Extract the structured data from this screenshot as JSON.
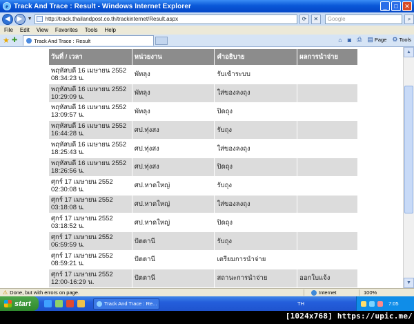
{
  "window": {
    "title": "Track And Trace : Result - Windows Internet Explorer",
    "address": "http://track.thailandpost.co.th/trackinternet/Result.aspx",
    "search_placeholder": "Google"
  },
  "menu": [
    "File",
    "Edit",
    "View",
    "Favorites",
    "Tools",
    "Help"
  ],
  "tab": {
    "label": "Track And Trace : Result"
  },
  "commands": {
    "page": "Page",
    "tools": "Tools"
  },
  "table": {
    "headers": [
      "วันที่ / เวลา",
      "หน่วยงาน",
      "คำอธิบาย",
      "ผลการนำจ่าย"
    ],
    "rows": [
      {
        "date": "พฤหัสบดี 16 เมษายน 2552",
        "time": "08:34:23 น.",
        "unit": "พัทลุง",
        "desc": "รับเข้าระบบ",
        "result": ""
      },
      {
        "date": "พฤหัสบดี 16 เมษายน 2552",
        "time": "10:29:09 น.",
        "unit": "พัทลุง",
        "desc": "ใส่ของลงถุง",
        "result": ""
      },
      {
        "date": "พฤหัสบดี 16 เมษายน 2552",
        "time": "13:09:57 น.",
        "unit": "พัทลุง",
        "desc": "ปิดถุง",
        "result": ""
      },
      {
        "date": "พฤหัสบดี 16 เมษายน 2552",
        "time": "16:44:28 น.",
        "unit": "ศป.ทุ่งสง",
        "desc": "รับถุง",
        "result": ""
      },
      {
        "date": "พฤหัสบดี 16 เมษายน 2552",
        "time": "18:25:43 น.",
        "unit": "ศป.ทุ่งสง",
        "desc": "ใส่ของลงถุง",
        "result": ""
      },
      {
        "date": "พฤหัสบดี 16 เมษายน 2552",
        "time": "18:26:56 น.",
        "unit": "ศป.ทุ่งสง",
        "desc": "ปิดถุง",
        "result": ""
      },
      {
        "date": "ศุกร์ 17 เมษายน 2552",
        "time": "02:30:08 น.",
        "unit": "ศป.หาดใหญ่",
        "desc": "รับถุง",
        "result": ""
      },
      {
        "date": "ศุกร์ 17 เมษายน 2552",
        "time": "03:18:08 น.",
        "unit": "ศป.หาดใหญ่",
        "desc": "ใส่ของลงถุง",
        "result": ""
      },
      {
        "date": "ศุกร์ 17 เมษายน 2552",
        "time": "03:18:52 น.",
        "unit": "ศป.หาดใหญ่",
        "desc": "ปิดถุง",
        "result": ""
      },
      {
        "date": "ศุกร์ 17 เมษายน 2552",
        "time": "06:59:59 น.",
        "unit": "ปัตตานี",
        "desc": "รับถุง",
        "result": ""
      },
      {
        "date": "ศุกร์ 17 เมษายน 2552",
        "time": "08:59:21 น.",
        "unit": "ปัตตานี",
        "desc": "เตรียมการนำจ่าย",
        "result": ""
      },
      {
        "date": "ศุกร์ 17 เมษายน 2552",
        "time": "12:00-16:29 น.",
        "unit": "ปัตตานี",
        "desc": "สถานะการนำจ่าย",
        "result": "ออกใบแจ้ง"
      }
    ]
  },
  "status": {
    "text": "Done, but with errors on page.",
    "zone": "Internet",
    "zoom": "100%"
  },
  "taskbar": {
    "start": "start",
    "task": "Track And Trace : Re...",
    "lang": "TH",
    "clock": "7:05"
  },
  "watermark": "[1024x768] https://upic.me/"
}
